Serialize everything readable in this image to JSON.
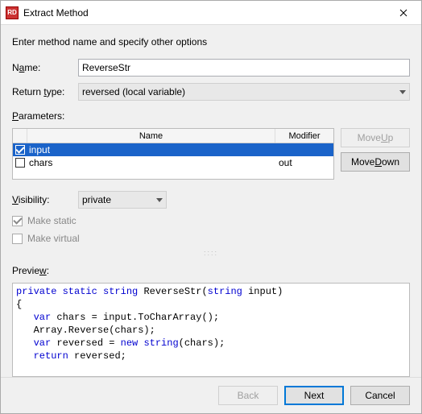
{
  "window": {
    "title": "Extract Method",
    "icon_label": "RD"
  },
  "instruction": "Enter method name and specify other options",
  "name": {
    "label_pre": "N",
    "label_hot": "a",
    "label_post": "me:",
    "value": "ReverseStr"
  },
  "return_type": {
    "label_pre": "Return ",
    "label_hot": "t",
    "label_post": "ype:",
    "value": "reversed (local variable)"
  },
  "params": {
    "label_pre": "",
    "label_hot": "P",
    "label_post": "arameters:",
    "col_name": "Name",
    "col_modifier": "Modifier",
    "rows": [
      {
        "checked": true,
        "name": "input",
        "modifier": "",
        "selected": true
      },
      {
        "checked": false,
        "name": "chars",
        "modifier": "out",
        "selected": false
      }
    ],
    "move_up_pre": "Move ",
    "move_up_hot": "U",
    "move_up_post": "p",
    "move_down_pre": "Move ",
    "move_down_hot": "D",
    "move_down_post": "own"
  },
  "visibility": {
    "label_pre": "",
    "label_hot": "V",
    "label_post": "isibility:",
    "value": "private"
  },
  "make_static": {
    "checked": true,
    "label": "Make static"
  },
  "make_virtual": {
    "checked": false,
    "label": "Make virtual"
  },
  "preview": {
    "label_pre": "Previe",
    "label_hot": "w",
    "label_post": ":",
    "kw1": "private static",
    "kw2": "string",
    "fn": " ReverseStr(",
    "kw3": "string",
    "arg": " input)",
    "l_open": "{",
    "l1a": "   ",
    "l1k": "var",
    "l1b": " chars = input.ToCharArray();",
    "l2": "   Array.Reverse(chars);",
    "l3a": "   ",
    "l3k1": "var",
    "l3b": " reversed = ",
    "l3k2": "new string",
    "l3c": "(chars);",
    "l4a": "   ",
    "l4k": "return",
    "l4b": " reversed;"
  },
  "footer": {
    "back": "Back",
    "next": "Next",
    "cancel": "Cancel"
  }
}
